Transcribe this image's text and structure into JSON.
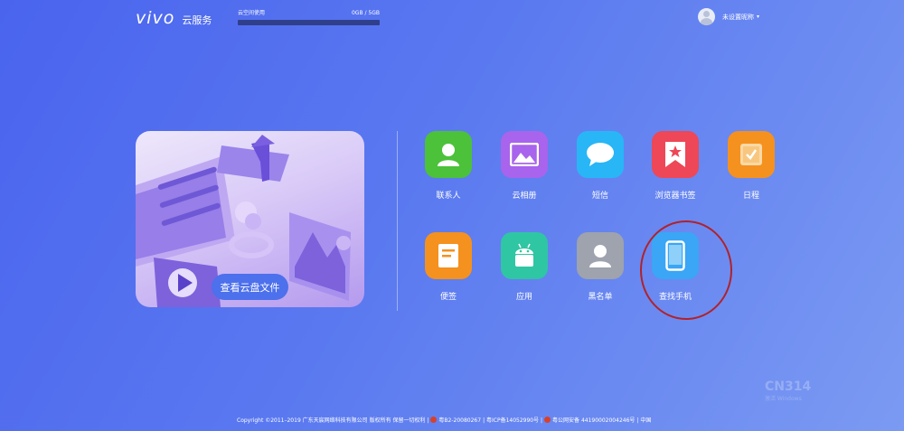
{
  "header": {
    "logo_mark": "vivo",
    "logo_sub": "云服务",
    "storage": {
      "label": "云空间使用",
      "value": "0GB / 5GB",
      "used_fraction": 0
    },
    "user": {
      "name": "未设置昵称",
      "chevron_icon": "chevron-down-icon"
    }
  },
  "banner": {
    "button_label": "查看云盘文件"
  },
  "apps": [
    {
      "label": "联系人",
      "icon": "contacts-icon",
      "color": "#4cc13a"
    },
    {
      "label": "云相册",
      "icon": "photo-icon",
      "color": "#a864ec"
    },
    {
      "label": "短信",
      "icon": "message-icon",
      "color": "#28b6f6"
    },
    {
      "label": "浏览器书签",
      "icon": "bookmark-icon",
      "color": "#ee4757"
    },
    {
      "label": "日程",
      "icon": "calendar-icon",
      "color": "#f5911e"
    },
    {
      "label": "便签",
      "icon": "note-icon",
      "color": "#f5911e"
    },
    {
      "label": "应用",
      "icon": "android-icon",
      "color": "#2fc6a4"
    },
    {
      "label": "黑名单",
      "icon": "blacklist-icon",
      "color": "#9ea3ad"
    },
    {
      "label": "查找手机",
      "icon": "phone-icon",
      "color": "#3aa6f5"
    }
  ],
  "footer": {
    "copyright": "Copyright ©2011–2019 广东天宸网络科技有限公司 版权所有 保留一切权利 |",
    "icp1": "粤B2-20080267",
    "icp2": "| 粤ICP备14052990号 |",
    "security": "粤公网安备 44190002004246号",
    "region": "| 中国"
  },
  "watermark": {
    "main": "CN314",
    "sub": "激活 Windows"
  }
}
